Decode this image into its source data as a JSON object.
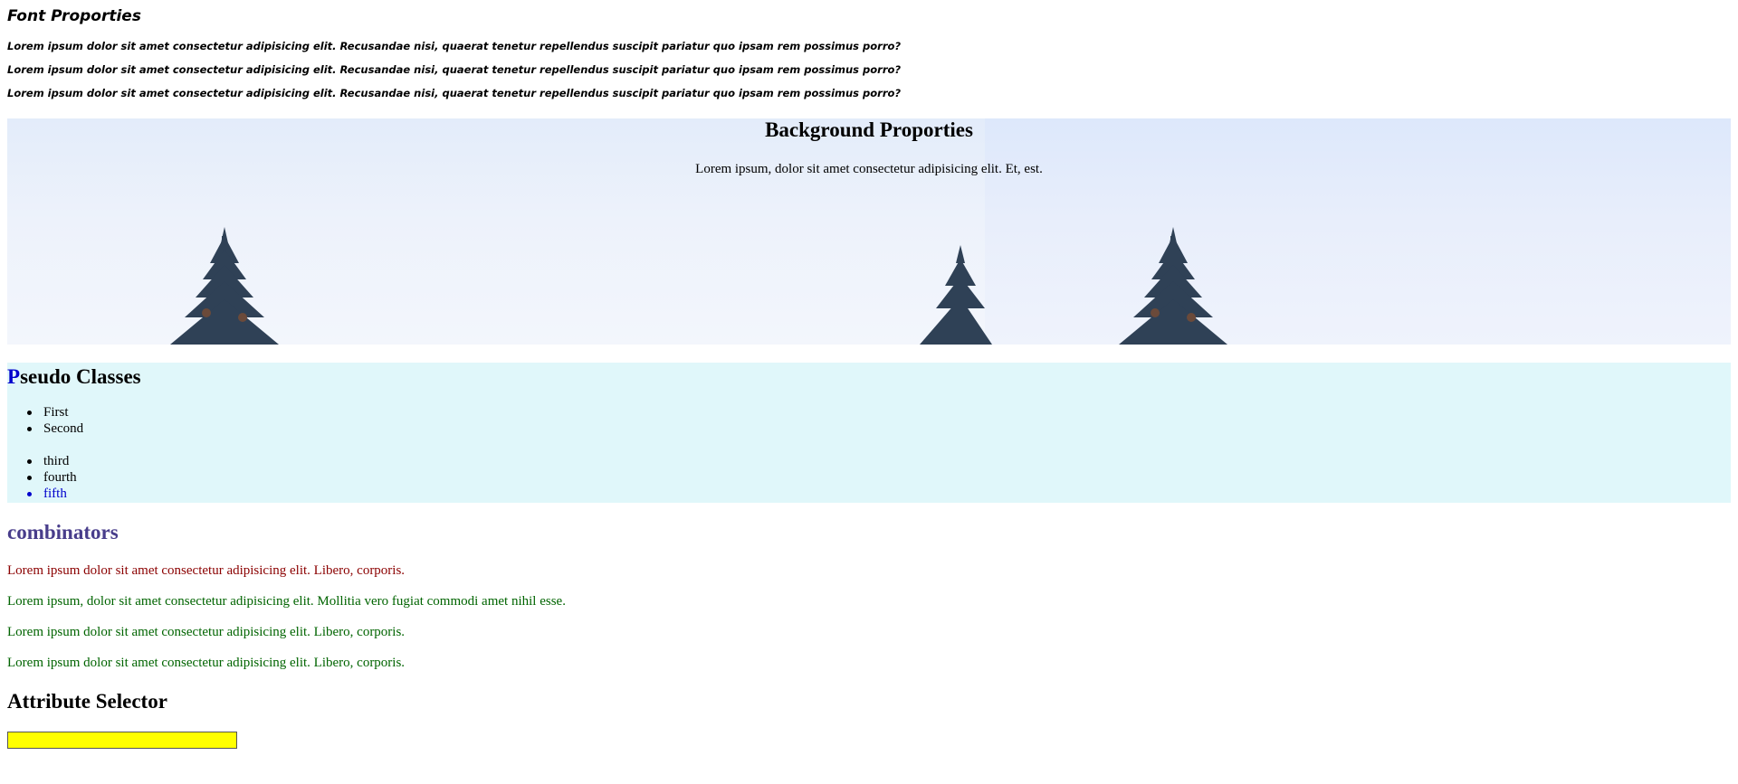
{
  "font_section": {
    "title": "Font Proporties",
    "paragraphs": [
      "Lorem ipsum dolor sit amet consectetur adipisicing elit. Recusandae nisi, quaerat tenetur repellendus suscipit pariatur quo ipsam rem possimus porro?",
      "Lorem ipsum dolor sit amet consectetur adipisicing elit. Recusandae nisi, quaerat tenetur repellendus suscipit pariatur quo ipsam rem possimus porro?",
      "Lorem ipsum dolor sit amet consectetur adipisicing elit. Recusandae nisi, quaerat tenetur repellendus suscipit pariatur quo ipsam rem possimus porro?"
    ]
  },
  "background_section": {
    "title": "Background Proporties",
    "text": "Lorem ipsum, dolor sit amet consectetur adipisicing elit. Et, est.",
    "sky_color": "#e3ecfa",
    "tree_color": "#2f4156"
  },
  "pseudo_section": {
    "title_first_letter": "P",
    "title_rest": "seudo Classes",
    "first_letter_color": "#0000cc",
    "background_color": "#e0f7fa",
    "list_one": [
      "First",
      "Second"
    ],
    "list_two": [
      "third",
      "fourth",
      "fifth"
    ],
    "highlighted_item": "fifth"
  },
  "combinators_section": {
    "title": "combinators",
    "title_color": "#483d8b",
    "paragraphs": [
      {
        "text": "Lorem ipsum dolor sit amet consectetur adipisicing elit. Libero, corporis.",
        "color": "#8b0000"
      },
      {
        "text": "Lorem ipsum, dolor sit amet consectetur adipisicing elit. Mollitia vero fugiat commodi amet nihil esse.",
        "color": "#006400"
      },
      {
        "text": "Lorem ipsum dolor sit amet consectetur adipisicing elit. Libero, corporis.",
        "color": "#006400"
      },
      {
        "text": "Lorem ipsum dolor sit amet consectetur adipisicing elit. Libero, corporis.",
        "color": "#006400"
      }
    ]
  },
  "attribute_section": {
    "title": "Attribute Selector",
    "input_value": "",
    "input_background": "#ffff00"
  }
}
